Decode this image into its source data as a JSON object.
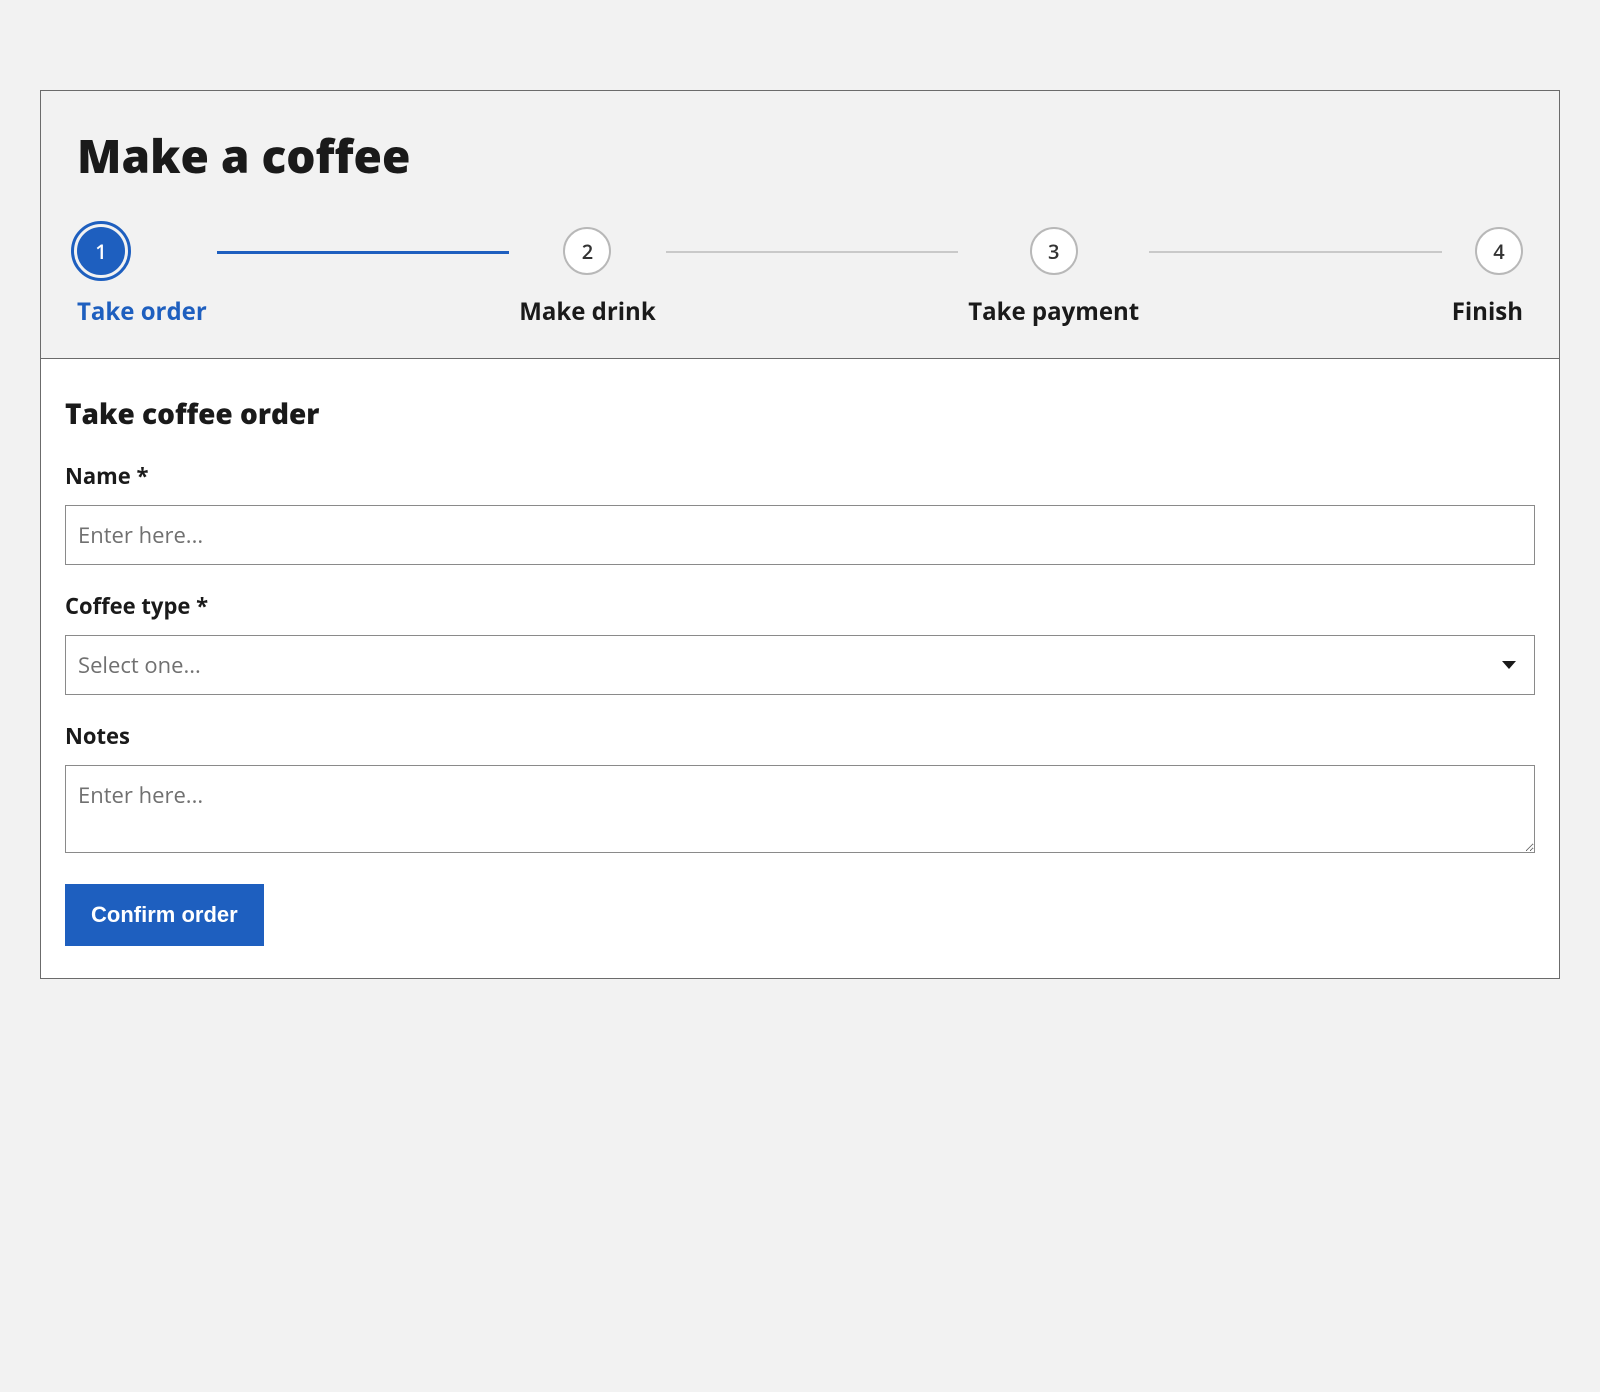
{
  "title": "Make a coffee",
  "stepper": {
    "current_index": 0,
    "steps": [
      {
        "number": "1",
        "label": "Take order"
      },
      {
        "number": "2",
        "label": "Make drink"
      },
      {
        "number": "3",
        "label": "Take payment"
      },
      {
        "number": "4",
        "label": "Finish"
      }
    ]
  },
  "panel": {
    "title": "Take coffee order",
    "fields": {
      "name": {
        "label": "Name *",
        "placeholder": "Enter here...",
        "value": ""
      },
      "coffee": {
        "label": "Coffee type *",
        "placeholder": "Select one...",
        "value": ""
      },
      "notes": {
        "label": "Notes",
        "placeholder": "Enter here...",
        "value": ""
      }
    },
    "submit_label": "Confirm order"
  },
  "colors": {
    "accent": "#1e5fbf",
    "border": "#6b6b6b",
    "page_bg": "#f2f2f2"
  }
}
